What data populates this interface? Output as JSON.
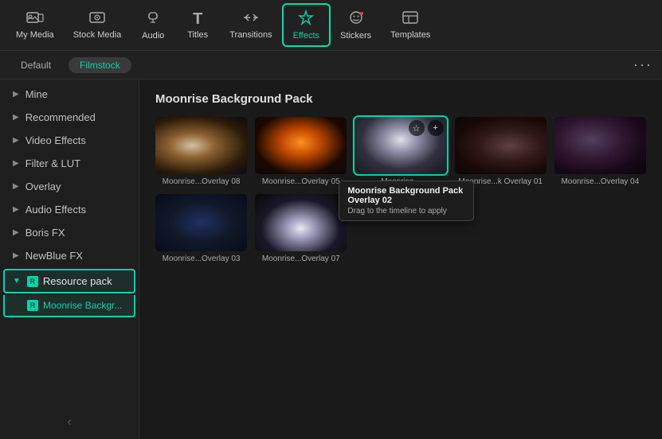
{
  "nav": {
    "items": [
      {
        "id": "my-media",
        "label": "My Media",
        "icon": "⊞",
        "active": false
      },
      {
        "id": "stock-media",
        "label": "Stock Media",
        "icon": "⊡",
        "active": false
      },
      {
        "id": "audio",
        "label": "Audio",
        "icon": "♪",
        "active": false
      },
      {
        "id": "titles",
        "label": "Titles",
        "icon": "T",
        "active": false
      },
      {
        "id": "transitions",
        "label": "Transitions",
        "icon": "⇒",
        "active": false
      },
      {
        "id": "effects",
        "label": "Effects",
        "icon": "✦",
        "active": true
      },
      {
        "id": "stickers",
        "label": "Stickers",
        "icon": "●",
        "active": false
      },
      {
        "id": "templates",
        "label": "Templates",
        "icon": "⊟",
        "active": false
      }
    ]
  },
  "filters": {
    "buttons": [
      "Default",
      "Filmstock"
    ],
    "active": "Filmstock",
    "more_label": "···"
  },
  "sidebar": {
    "items": [
      {
        "id": "mine",
        "label": "Mine",
        "has_chevron": true
      },
      {
        "id": "recommended",
        "label": "Recommended",
        "has_chevron": true
      },
      {
        "id": "video-effects",
        "label": "Video Effects",
        "has_chevron": true
      },
      {
        "id": "filter-lut",
        "label": "Filter & LUT",
        "has_chevron": true
      },
      {
        "id": "overlay",
        "label": "Overlay",
        "has_chevron": true
      },
      {
        "id": "audio-effects",
        "label": "Audio Effects",
        "has_chevron": true
      },
      {
        "id": "boris-fx",
        "label": "Boris FX",
        "has_chevron": true
      },
      {
        "id": "newblue-fx",
        "label": "NewBlue FX",
        "has_chevron": true
      }
    ],
    "resource_pack": {
      "label": "Resource pack",
      "active": true,
      "sub_item": "Moonrise Backgr..."
    },
    "collapse_label": "‹"
  },
  "content": {
    "title": "Moonrise Background Pack",
    "cards": [
      {
        "id": "overlay08",
        "label": "Moonrise...Overlay 08",
        "thumb_class": "thumb-moon08"
      },
      {
        "id": "overlay05",
        "label": "Moonrise...Overlay 05",
        "thumb_class": "thumb-moon05"
      },
      {
        "id": "overlay02",
        "label": "Moonrise...Overlay 02",
        "thumb_class": "thumb-moon02",
        "hovered": true
      },
      {
        "id": "overlayk01",
        "label": "Moonrise...k Overlay 01",
        "thumb_class": "thumb-moonk01"
      },
      {
        "id": "overlay04",
        "label": "Moonrise...Overlay 04",
        "thumb_class": "thumb-moon04"
      },
      {
        "id": "overlay03",
        "label": "Moonrise...Overlay 03",
        "thumb_class": "thumb-moon03"
      },
      {
        "id": "overlay07",
        "label": "Moonrise...Overlay 07",
        "thumb_class": "thumb-moon07"
      }
    ],
    "tooltip": {
      "title": "Moonrise Background Pack Overlay 02",
      "subtitle": "Drag to the timeline to apply"
    }
  }
}
